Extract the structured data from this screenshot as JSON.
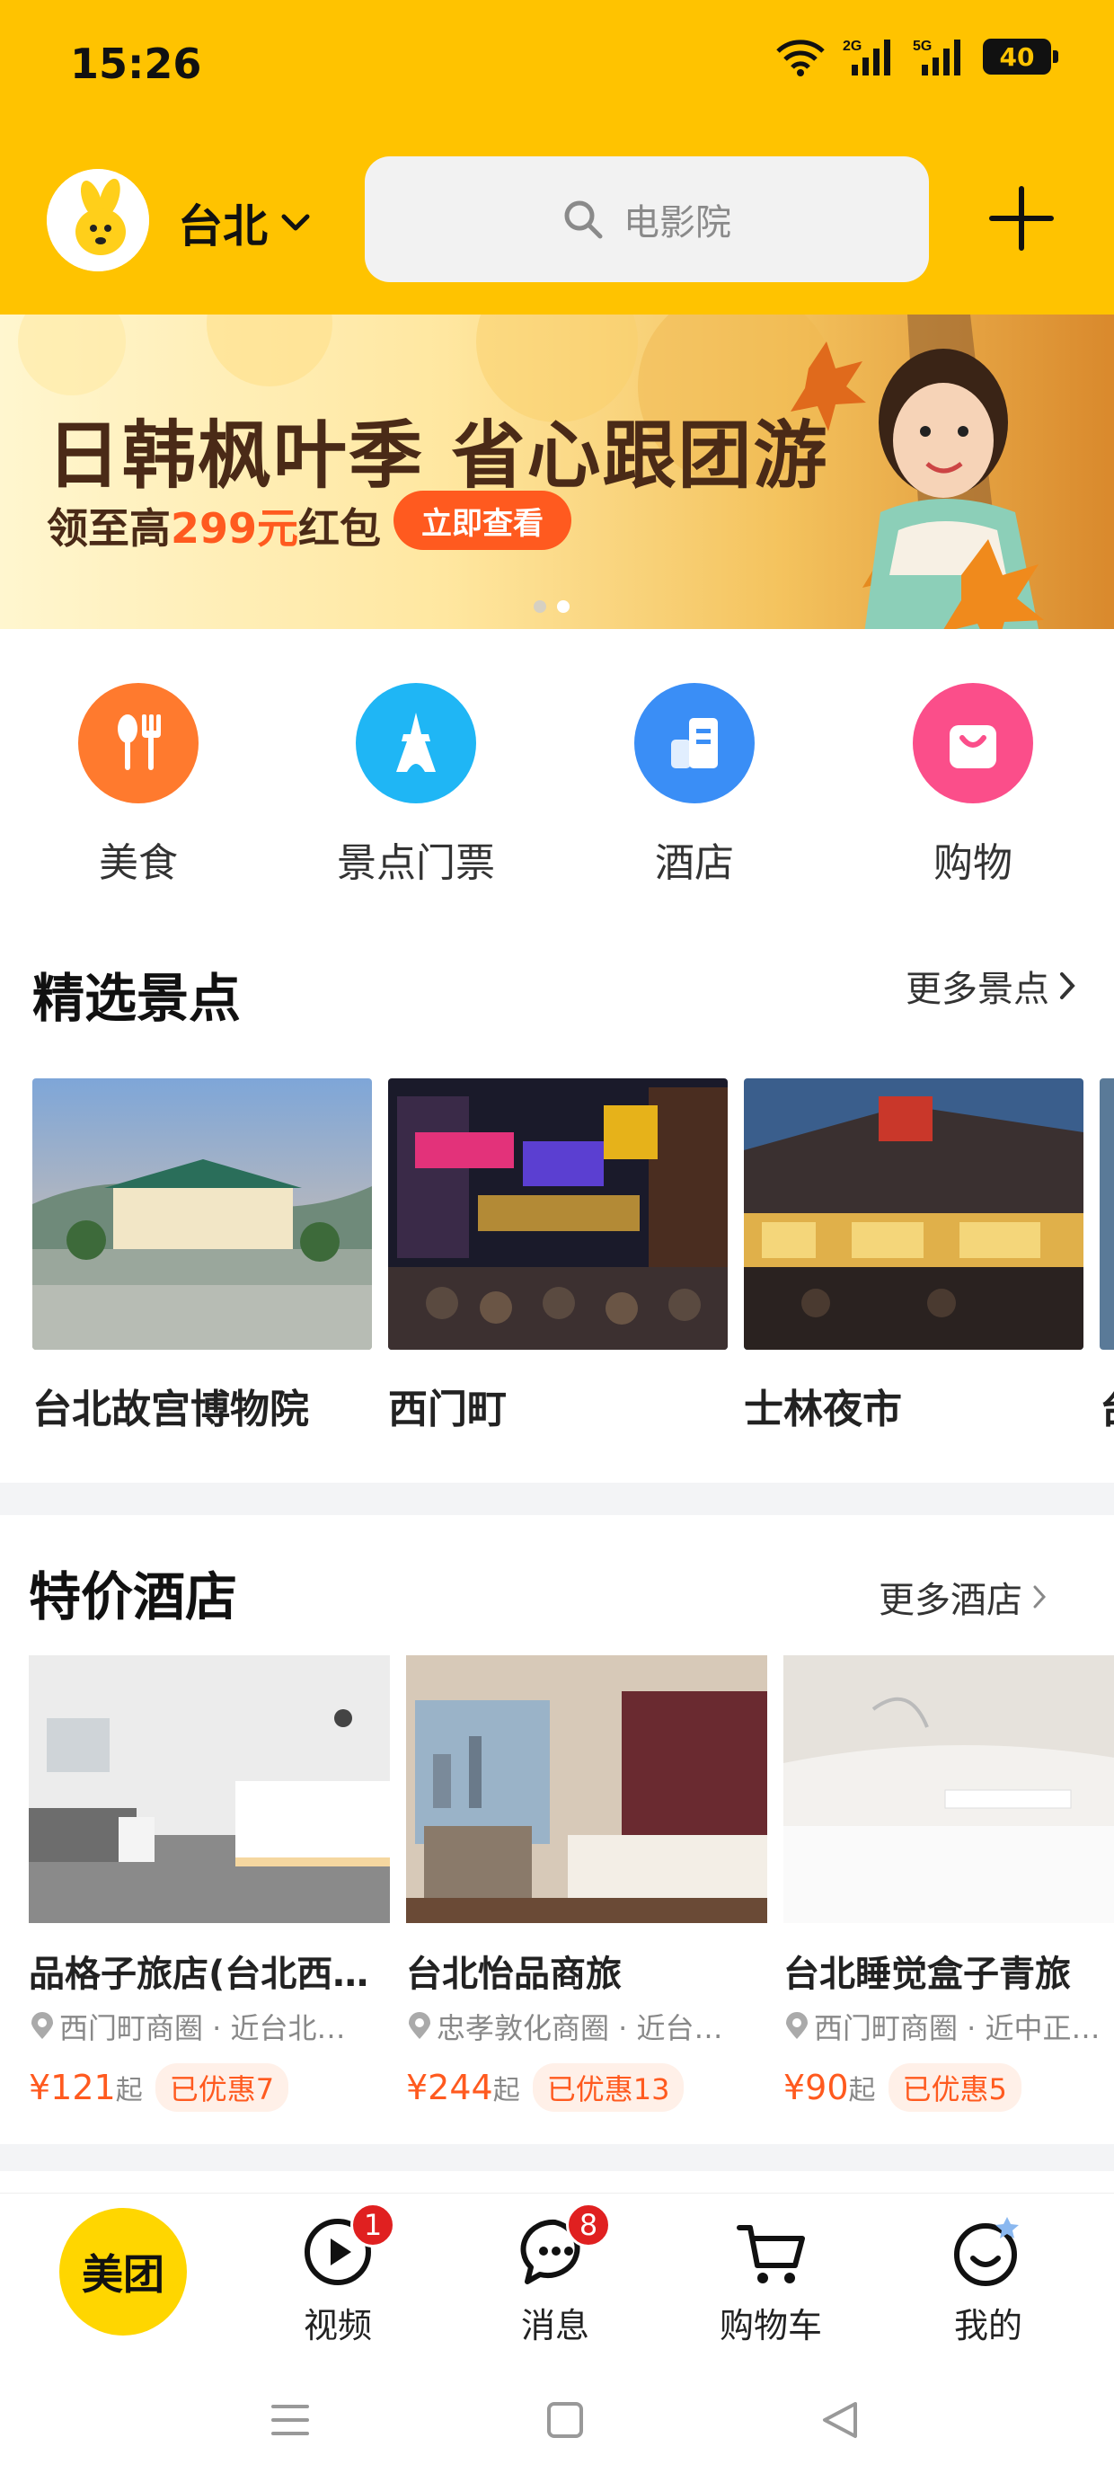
{
  "status_bar": {
    "time": "15:26",
    "battery": "40",
    "network_2g": "2G",
    "network_5g": "5G"
  },
  "header": {
    "city": "台北",
    "search_placeholder": "电影院"
  },
  "banner": {
    "title": "日韩枫叶季 省心跟团游",
    "subtitle_prefix": "领至高",
    "subtitle_highlight": "299元",
    "subtitle_suffix": "红包",
    "cta": "立即查看",
    "dots": 2,
    "active_dot": 1
  },
  "categories": [
    {
      "label": "美食",
      "icon": "food-icon",
      "color": "#ff7a2e"
    },
    {
      "label": "景点门票",
      "icon": "eiffel-tower-icon",
      "color": "#1fb6f5"
    },
    {
      "label": "酒店",
      "icon": "hotel-icon",
      "color": "#3a8ef6"
    },
    {
      "label": "购物",
      "icon": "shopping-bag-icon",
      "color": "#fb4e8a"
    }
  ],
  "attractions": {
    "title": "精选景点",
    "more": "更多景点",
    "items": [
      {
        "name": "台北故宫博物院"
      },
      {
        "name": "西门町"
      },
      {
        "name": "士林夜市"
      },
      {
        "name": "台"
      }
    ]
  },
  "hotels": {
    "title": "特价酒店",
    "more": "更多酒店",
    "items": [
      {
        "name": "品格子旅店(台北西…",
        "location": "西门町商圈 · 近台北…",
        "price": "¥121",
        "price_suffix": "起",
        "discount": "已优惠7"
      },
      {
        "name": "台北怡品商旅",
        "location": "忠孝敦化商圈 · 近台…",
        "price": "¥244",
        "price_suffix": "起",
        "discount": "已优惠13"
      },
      {
        "name": "台北睡觉盒子青旅",
        "location": "西门町商圈 · 近中正…",
        "price": "¥90",
        "price_suffix": "起",
        "discount": "已优惠5"
      }
    ]
  },
  "tabbar": {
    "home": "美团",
    "items": [
      {
        "label": "视频",
        "icon": "video-play-icon",
        "badge": "1"
      },
      {
        "label": "消息",
        "icon": "message-bubble-icon",
        "badge": "8"
      },
      {
        "label": "购物车",
        "icon": "shopping-cart-icon",
        "badge": ""
      },
      {
        "label": "我的",
        "icon": "smile-profile-icon",
        "badge": ""
      }
    ]
  },
  "colors": {
    "brand_yellow": "#ffc300",
    "accent_orange": "#ff5a1f",
    "badge_red": "#e02020"
  }
}
